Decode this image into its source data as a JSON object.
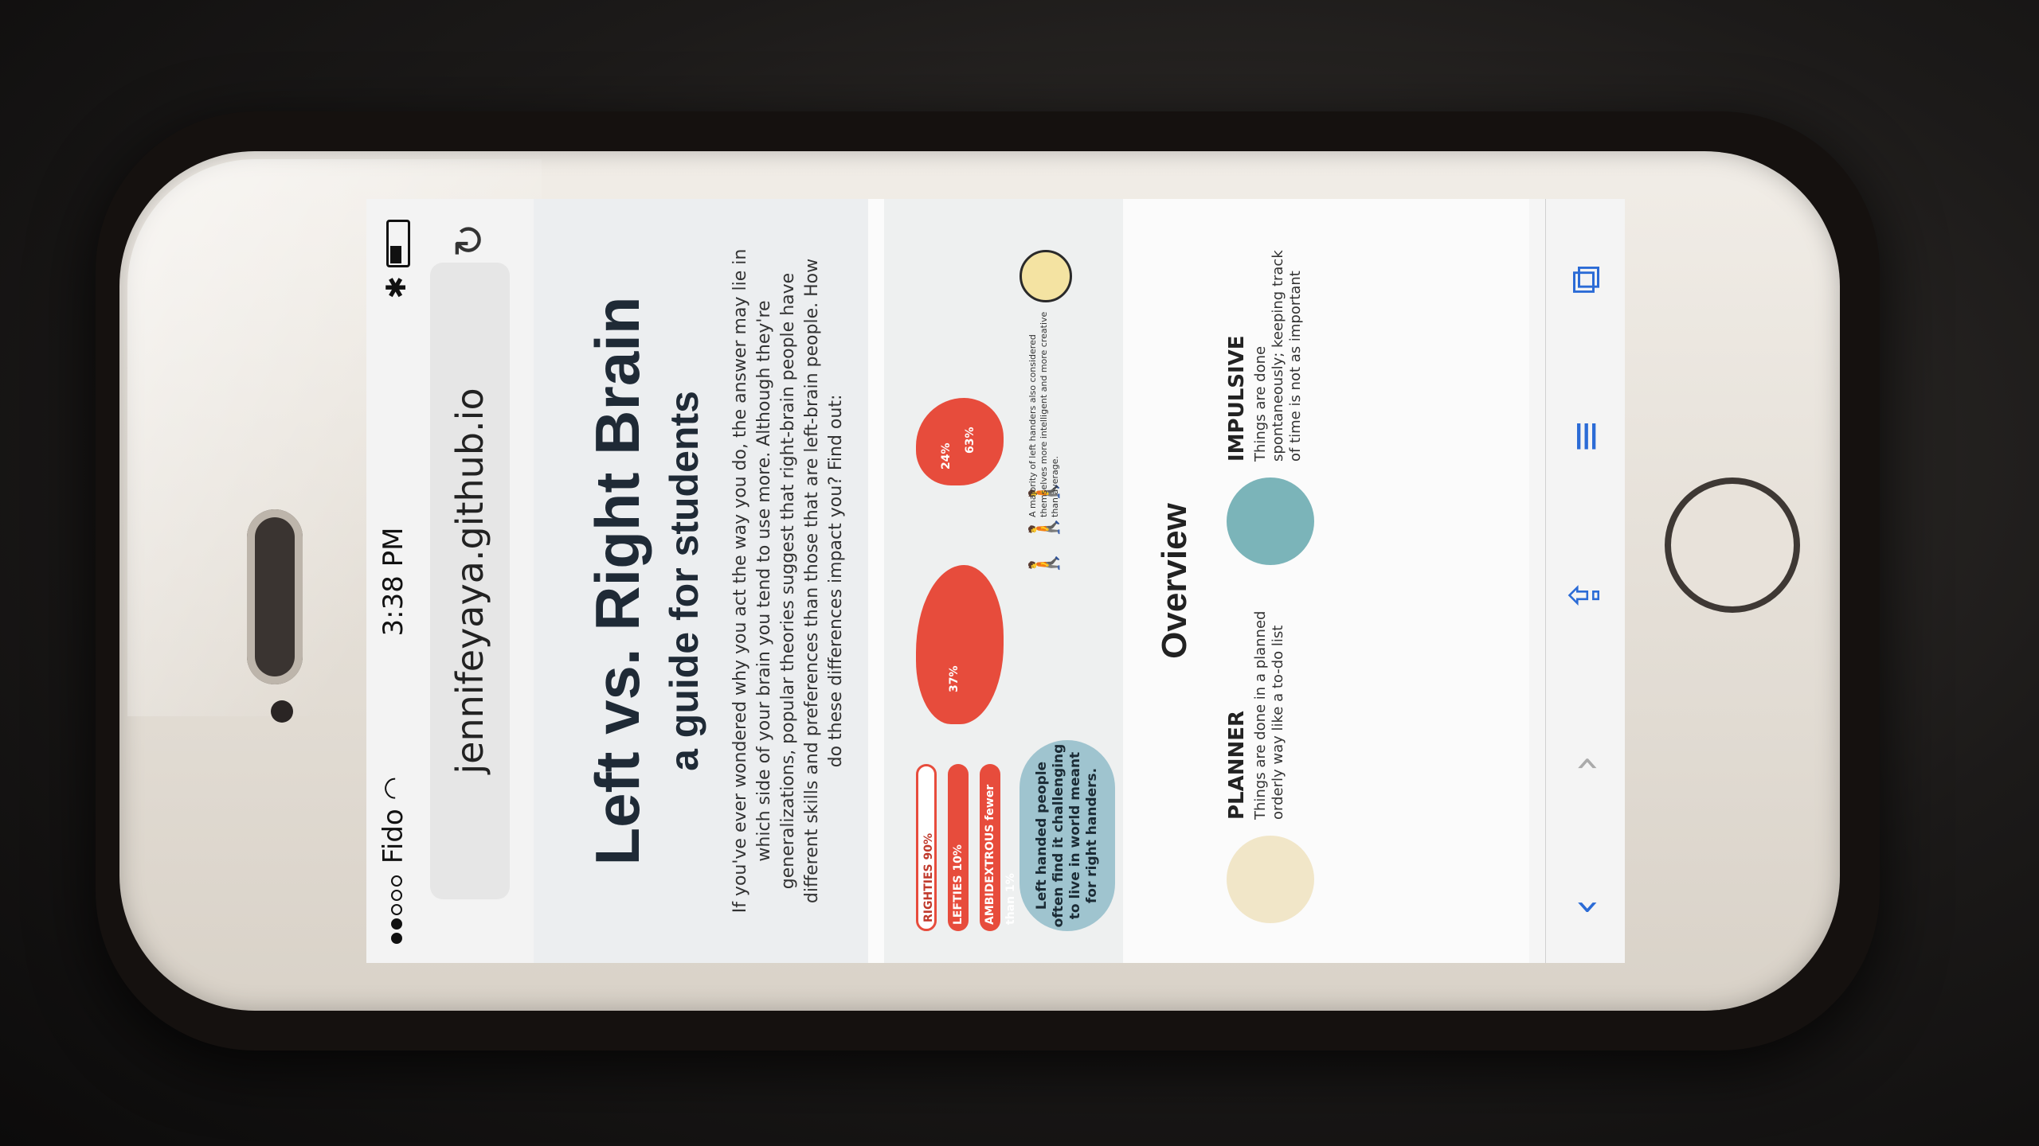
{
  "status_bar": {
    "carrier": "Fido",
    "time": "3:38 PM"
  },
  "browser": {
    "url": "jennifeyaya.github.io"
  },
  "page": {
    "title": "Left vs. Right Brain",
    "subtitle": "a guide for students",
    "intro": "If you've ever wondered why you act the way you do, the answer may lie in which side of your brain you tend to use more. Although they're generalizations, popular theories suggest that right-brain people have different skills and preferences than those that are left-brain people. How do these differences impact you? Find out:",
    "infographic": {
      "bars": [
        {
          "label": "RIGHTIES 90%"
        },
        {
          "label": "LEFTIES 10%"
        },
        {
          "label": "AMBIDEXTROUS fewer than 1%"
        }
      ],
      "callout": "Left handed people often find it challenging to live in world meant for right handers.",
      "map_percents": [
        "37%",
        "24%",
        "63%"
      ],
      "stat_line": "A majority of left handers also considered themselves more intelligent and more creative than average."
    },
    "overview_heading": "Overview",
    "traits": [
      {
        "name": "PLANNER",
        "desc": "Things are done in a planned orderly way like a to-do list"
      },
      {
        "name": "IMPULSIVE",
        "desc": "Things are done spontaneously; keeping track of time is not as important"
      }
    ]
  },
  "toolbar": {
    "back_icon": "chevron-left-icon",
    "forward_icon": "chevron-right-icon",
    "share_icon": "share-icon",
    "bookmarks_icon": "book-icon",
    "tabs_icon": "tabs-icon"
  },
  "colors": {
    "accent": "#e74c3c",
    "link_blue": "#2b6bd6",
    "teal": "#7bb4b9"
  }
}
